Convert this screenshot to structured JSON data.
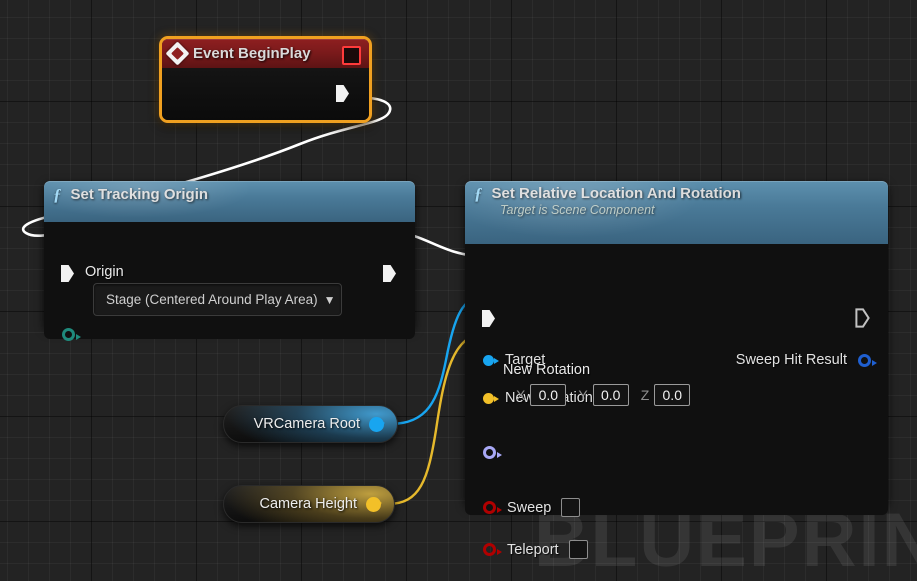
{
  "canvas": {
    "watermark": "BLUEPRINT",
    "background_color": "#232323",
    "grid_minor_color": "rgba(255,255,255,0.045)",
    "grid_major_color": "rgba(0,0,0,0.55)"
  },
  "nodes": {
    "event_begin_play": {
      "title": "Event BeginPlay",
      "type": "event",
      "selected": true,
      "selection_color": "#f0a020",
      "header_color": "#8e1f20",
      "icon": "event-diamond-icon",
      "stop_icon": "red-square-icon",
      "output_exec_pin": "exec-out"
    },
    "set_tracking_origin": {
      "title": "Set Tracking Origin",
      "subtitle": "",
      "icon": "function-f-icon",
      "header_color": "#4a7a98",
      "inputs": [
        {
          "name": "exec-in",
          "kind": "exec",
          "label": ""
        },
        {
          "name": "Origin",
          "kind": "enum",
          "label": "Origin",
          "color": "#1f8a7c",
          "value": "Stage (Centered Around Play Area)"
        }
      ],
      "outputs": [
        {
          "name": "exec-out",
          "kind": "exec",
          "label": ""
        }
      ]
    },
    "set_relative_location_and_rotation": {
      "title": "Set Relative Location And Rotation",
      "subtitle": "Target is Scene Component",
      "icon": "function-f-icon",
      "header_color": "#4a7a98",
      "inputs": [
        {
          "name": "exec-in",
          "kind": "exec",
          "label": ""
        },
        {
          "name": "Target",
          "kind": "object",
          "label": "Target",
          "color": "#18a5f0",
          "connected": true
        },
        {
          "name": "New Location",
          "kind": "vector",
          "label": "New Location",
          "color": "#f2c028",
          "connected": true
        },
        {
          "name": "New Rotation",
          "kind": "rotator",
          "label": "New Rotation",
          "color": "#a8a8f5",
          "connected": false,
          "axes": [
            {
              "axis": "X",
              "value": "0.0"
            },
            {
              "axis": "Y",
              "value": "0.0"
            },
            {
              "axis": "Z",
              "value": "0.0"
            }
          ]
        },
        {
          "name": "Sweep",
          "kind": "bool",
          "label": "Sweep",
          "color": "#b00000",
          "checked": false
        },
        {
          "name": "Teleport",
          "kind": "bool",
          "label": "Teleport",
          "color": "#b00000",
          "checked": false
        }
      ],
      "outputs": [
        {
          "name": "exec-out",
          "kind": "exec",
          "label": ""
        },
        {
          "name": "Sweep Hit Result",
          "kind": "struct",
          "label": "Sweep Hit Result",
          "color": "#1f5fd0"
        }
      ]
    },
    "var_vrcamera_root": {
      "title": "VRCamera Root",
      "type": "variable-get",
      "pin_color": "#18a5f0"
    },
    "var_camera_height": {
      "title": "Camera Height",
      "type": "variable-get",
      "pin_color": "#f2c028"
    }
  },
  "wires": [
    {
      "name": "exec-beginplay-to-settrackingorigin",
      "color": "#ffffff",
      "kind": "exec"
    },
    {
      "name": "exec-settrackingorigin-to-setrelative",
      "color": "#ffffff",
      "kind": "exec"
    },
    {
      "name": "data-vrcameraroot-to-target",
      "color": "#18a5f0",
      "kind": "data"
    },
    {
      "name": "data-cameraheight-to-newlocation",
      "color": "#e6b92c",
      "kind": "data"
    }
  ]
}
